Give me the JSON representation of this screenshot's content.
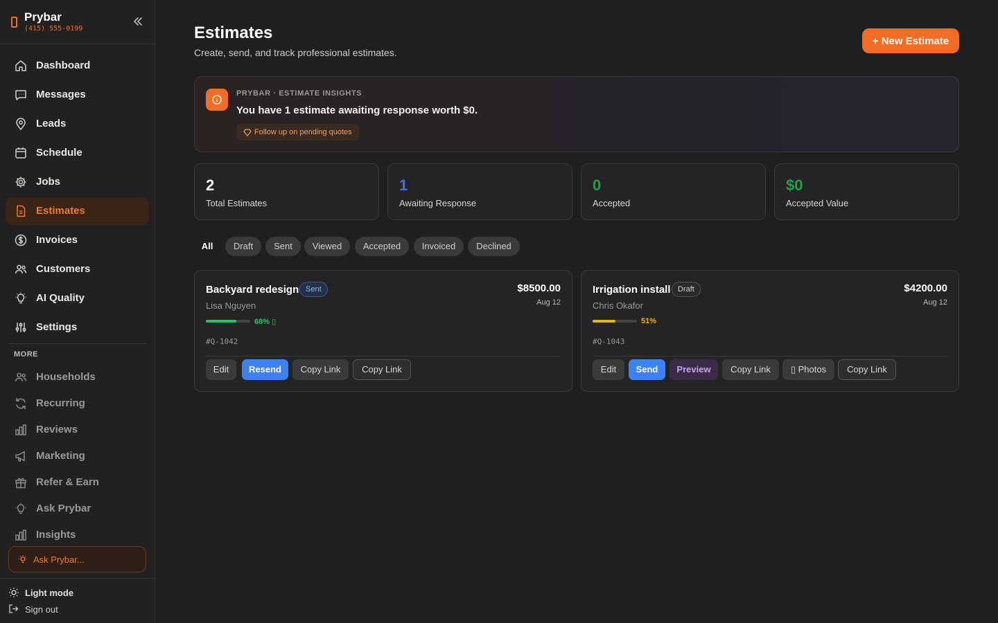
{
  "app": {
    "name": "Prybar",
    "phone": "(415) 555-0199"
  },
  "sidebar": {
    "items": [
      {
        "label": "Dashboard",
        "icon": "home-icon"
      },
      {
        "label": "Messages",
        "icon": "message-icon"
      },
      {
        "label": "Leads",
        "icon": "map-pin-icon"
      },
      {
        "label": "Schedule",
        "icon": "calendar-icon"
      },
      {
        "label": "Jobs",
        "icon": "gear-icon"
      },
      {
        "label": "Estimates",
        "icon": "document-icon",
        "active": true
      },
      {
        "label": "Invoices",
        "icon": "dollar-icon"
      },
      {
        "label": "Customers",
        "icon": "users-icon"
      },
      {
        "label": "AI Quality",
        "icon": "lightbulb-icon"
      },
      {
        "label": "Settings",
        "icon": "sliders-icon"
      }
    ],
    "more_label": "MORE",
    "more_items": [
      {
        "label": "Households",
        "icon": "users-icon"
      },
      {
        "label": "Recurring",
        "icon": "refresh-icon"
      },
      {
        "label": "Reviews",
        "icon": "bar-chart-icon"
      },
      {
        "label": "Marketing",
        "icon": "megaphone-icon"
      },
      {
        "label": "Refer & Earn",
        "icon": "gift-icon"
      },
      {
        "label": "Ask Prybar",
        "icon": "lightbulb-icon"
      },
      {
        "label": "Insights",
        "icon": "bar-chart-icon"
      }
    ],
    "ask_placeholder": "Ask Prybar...",
    "light_mode": "Light mode",
    "sign_out": "Sign out"
  },
  "header": {
    "title": "Estimates",
    "subtitle": "Create, send, and track professional estimates.",
    "new_button": "+  New Estimate"
  },
  "insight": {
    "label": "PRYBAR · ESTIMATE INSIGHTS",
    "text": "You have 1 estimate awaiting response worth $0.",
    "chip": "Follow up on pending quotes"
  },
  "stats": [
    {
      "value": "2",
      "label": "Total Estimates",
      "color": "#ffffff"
    },
    {
      "value": "1",
      "label": "Awaiting Response",
      "color": "#3b6ff0"
    },
    {
      "value": "0",
      "label": "Accepted",
      "color": "#22a04a"
    },
    {
      "value": "$0",
      "label": "Accepted Value",
      "color": "#22a04a"
    }
  ],
  "filters": [
    "All",
    "Draft",
    "Sent",
    "Viewed",
    "Accepted",
    "Invoiced",
    "Declined"
  ],
  "estimates": [
    {
      "title": "Backyard redesign",
      "status": "Sent",
      "customer": "Lisa Nguyen",
      "amount": "$8500.00",
      "date": "Aug 12",
      "progress": 68,
      "progress_label": "68% ▯",
      "progress_color": "#22c55e",
      "id": "#Q-1042",
      "actions": [
        "Edit",
        "Resend",
        "Copy Link",
        "Copy Link"
      ]
    },
    {
      "title": "Irrigation install",
      "status": "Draft",
      "customer": "Chris Okafor",
      "amount": "$4200.00",
      "date": "Aug 12",
      "progress": 51,
      "progress_label": "51%",
      "progress_color": "#eab308",
      "id": "#Q-1043",
      "actions": [
        "Edit",
        "Send",
        "Preview",
        "Copy Link",
        "▯ Photos",
        "Copy Link"
      ]
    }
  ]
}
